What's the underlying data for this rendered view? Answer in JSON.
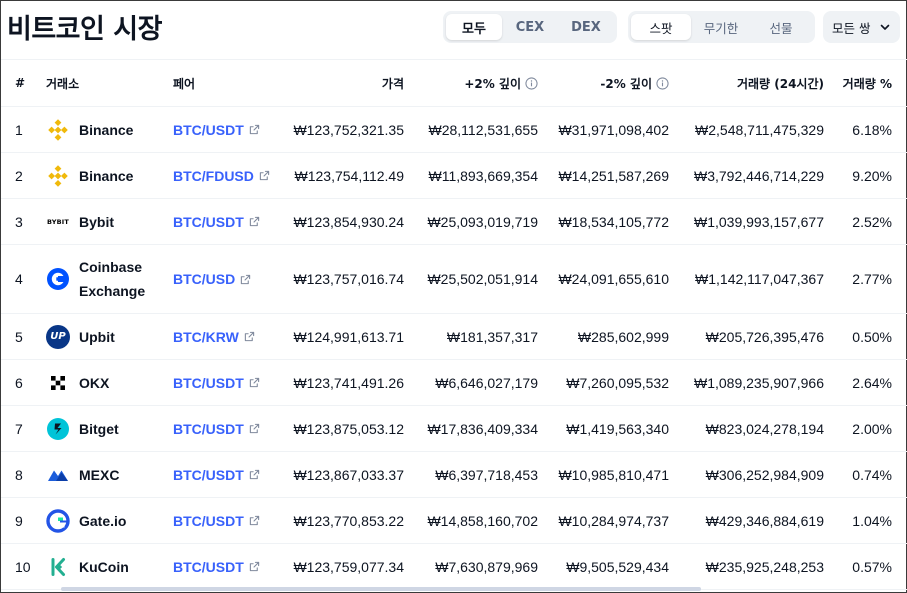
{
  "page": {
    "title": "비트코인 시장"
  },
  "filters": {
    "market_type": [
      {
        "label": "모두",
        "active": true
      },
      {
        "label": "CEX",
        "active": false
      },
      {
        "label": "DEX",
        "active": false
      }
    ],
    "instrument": [
      {
        "label": "스팟",
        "active": true
      },
      {
        "label": "무기한",
        "active": false
      },
      {
        "label": "선물",
        "active": false
      }
    ],
    "pair_select": {
      "label": "모든 쌍",
      "icon": "chevron-down-icon"
    }
  },
  "table": {
    "headers": {
      "rank": "#",
      "exchange": "거래소",
      "pair": "페어",
      "price": "가격",
      "depth_plus": "+2% 깊이",
      "depth_minus": "-2% 깊이",
      "volume": "거래량 (24시간)",
      "volume_pct": "거래량 %"
    },
    "rows": [
      {
        "rank": "1",
        "exchange": "Binance",
        "logo": "binance-logo",
        "pair": "BTC/USDT",
        "price": "₩123,752,321.35",
        "depth_plus": "₩28,112,531,655",
        "depth_minus": "₩31,971,098,402",
        "volume": "₩2,548,711,475,329",
        "volume_pct": "6.18%"
      },
      {
        "rank": "2",
        "exchange": "Binance",
        "logo": "binance-logo",
        "pair": "BTC/FDUSD",
        "price": "₩123,754,112.49",
        "depth_plus": "₩11,893,669,354",
        "depth_minus": "₩14,251,587,269",
        "volume": "₩3,792,446,714,229",
        "volume_pct": "9.20%"
      },
      {
        "rank": "3",
        "exchange": "Bybit",
        "logo": "bybit-logo",
        "logo_text": "BYBIT",
        "pair": "BTC/USDT",
        "price": "₩123,854,930.24",
        "depth_plus": "₩25,093,019,719",
        "depth_minus": "₩18,534,105,772",
        "volume": "₩1,039,993,157,677",
        "volume_pct": "2.52%"
      },
      {
        "rank": "4",
        "exchange": "Coinbase Exchange",
        "logo": "coinbase-logo",
        "pair": "BTC/USD",
        "price": "₩123,757,016.74",
        "depth_plus": "₩25,502,051,914",
        "depth_minus": "₩24,091,655,610",
        "volume": "₩1,142,117,047,367",
        "volume_pct": "2.77%"
      },
      {
        "rank": "5",
        "exchange": "Upbit",
        "logo": "upbit-logo",
        "logo_text": "UP",
        "pair": "BTC/KRW",
        "price": "₩124,991,613.71",
        "depth_plus": "₩181,357,317",
        "depth_minus": "₩285,602,999",
        "volume": "₩205,726,395,476",
        "volume_pct": "0.50%"
      },
      {
        "rank": "6",
        "exchange": "OKX",
        "logo": "okx-logo",
        "pair": "BTC/USDT",
        "price": "₩123,741,491.26",
        "depth_plus": "₩6,646,027,179",
        "depth_minus": "₩7,260,095,532",
        "volume": "₩1,089,235,907,966",
        "volume_pct": "2.64%"
      },
      {
        "rank": "7",
        "exchange": "Bitget",
        "logo": "bitget-logo",
        "pair": "BTC/USDT",
        "price": "₩123,875,053.12",
        "depth_plus": "₩17,836,409,334",
        "depth_minus": "₩1,419,563,340",
        "volume": "₩823,024,278,194",
        "volume_pct": "2.00%"
      },
      {
        "rank": "8",
        "exchange": "MEXC",
        "logo": "mexc-logo",
        "pair": "BTC/USDT",
        "price": "₩123,867,033.37",
        "depth_plus": "₩6,397,718,453",
        "depth_minus": "₩10,985,810,471",
        "volume": "₩306,252,984,909",
        "volume_pct": "0.74%"
      },
      {
        "rank": "9",
        "exchange": "Gate.io",
        "logo": "gateio-logo",
        "pair": "BTC/USDT",
        "price": "₩123,770,853.22",
        "depth_plus": "₩14,858,160,702",
        "depth_minus": "₩10,284,974,737",
        "volume": "₩429,346,884,619",
        "volume_pct": "1.04%"
      },
      {
        "rank": "10",
        "exchange": "KuCoin",
        "logo": "kucoin-logo",
        "pair": "BTC/USDT",
        "price": "₩123,759,077.34",
        "depth_plus": "₩7,630,879,969",
        "depth_minus": "₩9,505,529,434",
        "volume": "₩235,925,248,253",
        "volume_pct": "0.57%"
      }
    ]
  },
  "colors": {
    "link": "#3861fb",
    "text": "#0d1421",
    "muted": "#58667e",
    "segment_bg": "#eff2f5",
    "binance": "#f0b90b",
    "coinbase": "#0052ff",
    "upbit": "#093687",
    "bitget": "#00c4d8",
    "mexc": "#1c5ddb",
    "gateio": "#2354e6",
    "kucoin": "#23af91"
  }
}
